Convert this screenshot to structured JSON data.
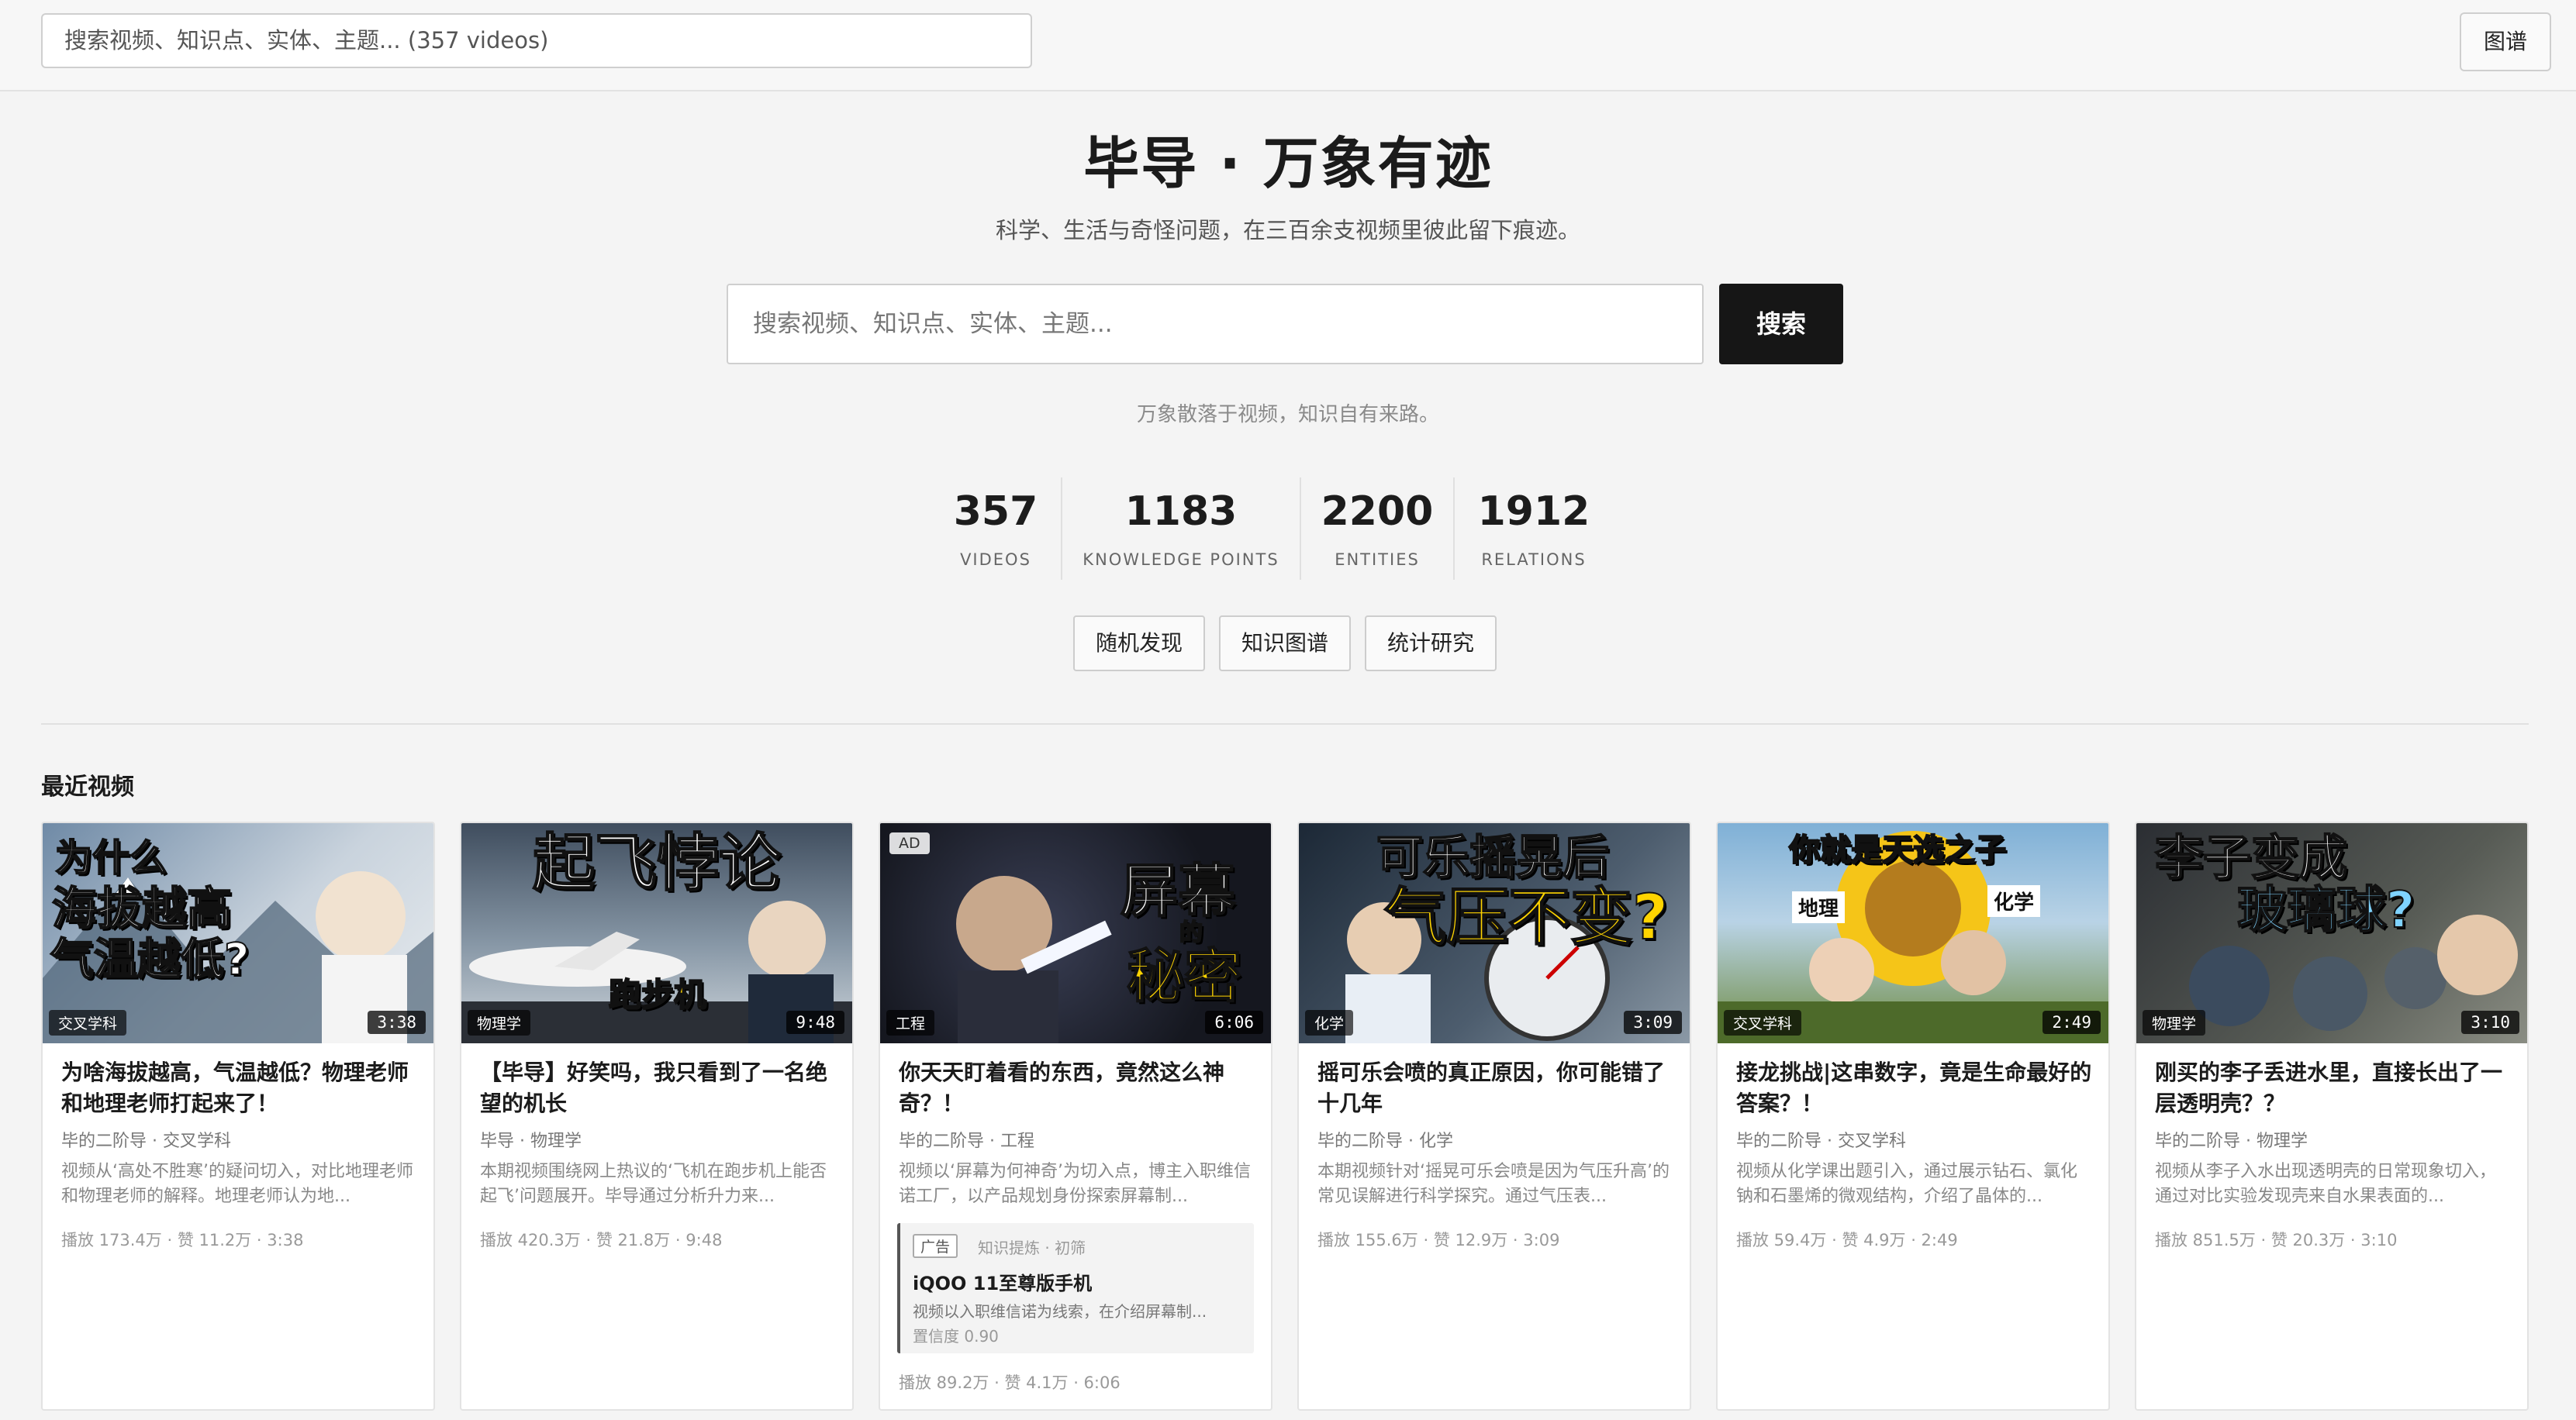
{
  "topbar": {
    "search_placeholder": "搜索视频、知识点、实体、主题... (357 videos)",
    "map_label": "图谱"
  },
  "hero": {
    "title": "毕导 · 万象有迹",
    "subtitle": "科学、生活与奇怪问题，在三百余支视频里彼此留下痕迹。",
    "search_placeholder": "搜索视频、知识点、实体、主题...",
    "search_button": "搜索",
    "tagline": "万象散落于视频，知识自有来路。"
  },
  "stats": [
    {
      "value": "357",
      "label": "VIDEOS"
    },
    {
      "value": "1183",
      "label": "KNOWLEDGE POINTS"
    },
    {
      "value": "2200",
      "label": "ENTITIES"
    },
    {
      "value": "1912",
      "label": "RELATIONS"
    }
  ],
  "actions": [
    "随机发现",
    "知识图谱",
    "统计研究"
  ],
  "section_title": "最近视频",
  "cards": [
    {
      "thumb_lines": [
        "为什么",
        "海拔越高",
        "气温越低?"
      ],
      "category": "交叉学科",
      "duration": "3:38",
      "title": "为啥海拔越高，气温越低？物理老师和地理老师打起来了！",
      "author": "毕的二阶导 · 交叉学科",
      "desc": "视频从‘高处不胜寒’的疑问切入，对比地理老师和物理老师的解释。地理老师认为地...",
      "meta": "播放 173.4万 · 赞 11.2万 · 3:38",
      "colors": [
        "#8fa3b8",
        "#d7dde4"
      ]
    },
    {
      "thumb_lines": [
        "起飞悖论"
      ],
      "thumb_sub": "跑步机",
      "category": "物理学",
      "duration": "9:48",
      "title": "【毕导】好笑吗，我只看到了一名绝望的机长",
      "author": "毕导 · 物理学",
      "desc": "本期视频围绕网上热议的‘飞机在跑步机上能否起飞’问题展开。毕导通过分析升力来...",
      "meta": "播放 420.3万 · 赞 21.8万 · 9:48",
      "colors": [
        "#5e6e80",
        "#b9c3cc"
      ]
    },
    {
      "ad_label": "AD",
      "thumb_lines": [
        "屏幕",
        "的",
        "秘密"
      ],
      "category": "工程",
      "duration": "6:06",
      "title": "你天天盯着看的东西，竟然这么神奇？！",
      "author": "毕的二阶导 · 工程",
      "desc": "视频以‘屏幕为何神奇’为切入点，博主入职维信诺工厂，以产品规划身份探索屏幕制...",
      "ad": {
        "tag": "广告",
        "source": "知识提炼 · 初筛",
        "name": "iQOO 11至尊版手机",
        "desc": "视频以入职维信诺为线索，在介绍屏幕制...",
        "confidence": "置信度 0.90"
      },
      "meta": "播放 89.2万 · 赞 4.1万 · 6:06",
      "colors": [
        "#1a1d2b",
        "#3a3f55"
      ]
    },
    {
      "thumb_lines": [
        "可乐摇晃后",
        "气压不变?"
      ],
      "category": "化学",
      "duration": "3:09",
      "title": "摇可乐会喷的真正原因，你可能错了十几年",
      "author": "毕的二阶导 · 化学",
      "desc": "本期视频针对‘摇晃可乐会喷是因为气压升高’的常见误解进行科学探究。通过气压表...",
      "meta": "播放 155.6万 · 赞 12.9万 · 3:09",
      "colors": [
        "#243547",
        "#6a7a8a"
      ]
    },
    {
      "thumb_lines": [
        "你就是天选之子"
      ],
      "thumb_left": "地理",
      "thumb_right": "化学",
      "category": "交叉学科",
      "duration": "2:49",
      "title": "接龙挑战|这串数字，竟是生命最好的答案？！",
      "author": "毕的二阶导 · 交叉学科",
      "desc": "视频从化学课出题引入，通过展示钻石、氯化钠和石墨烯的微观结构，介绍了晶体的...",
      "meta": "播放 59.4万 · 赞 4.9万 · 2:49",
      "colors": [
        "#7fb0d6",
        "#6d8a3f"
      ]
    },
    {
      "thumb_lines": [
        "李子变成",
        "玻璃球?"
      ],
      "category": "物理学",
      "duration": "3:10",
      "title": "刚买的李子丢进水里，直接长出了一层透明壳？？",
      "author": "毕的二阶导 · 物理学",
      "desc": "视频从李子入水出现透明壳的日常现象切入，通过对比实验发现壳来自水果表面的...",
      "meta": "播放 851.5万 · 赞 20.3万 · 3:10",
      "colors": [
        "#2b2e33",
        "#6b6f6a"
      ]
    }
  ]
}
